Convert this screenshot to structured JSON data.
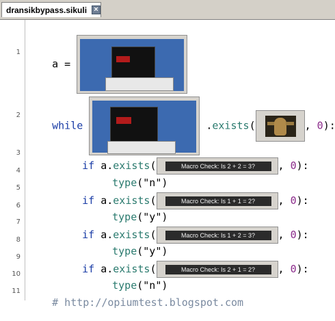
{
  "tab": {
    "title": "dransikbypass.sikuli",
    "close_icon": "close-icon"
  },
  "gutter": {
    "numbers": [
      "1",
      "2",
      "3",
      "4",
      "5",
      "6",
      "7",
      "8",
      "9",
      "10",
      "11"
    ]
  },
  "code": {
    "l1_var": "a",
    "l1_eq": " = ",
    "l2_kw": "while",
    "l2_dot": " .",
    "l2_fn": "exists",
    "l2_open": "(",
    "l2_comma": ", ",
    "l2_num": "0",
    "l2_close": "):",
    "if_kw": "if",
    "a_dot": " a.",
    "exists_fn": "exists",
    "open": "(",
    "comma": ", ",
    "zero": "0",
    "close_colon": "):",
    "type_fn": "type",
    "l4_arg": "(\"n\")",
    "l6_arg": "(\"y\")",
    "l8_arg": "(\"y\")",
    "l10_arg": "(\"n\")",
    "comment": "# http://opiumtest.blogspot.com"
  },
  "patterns": {
    "check1": "Macro Check: Is 2 + 2 = 3?",
    "check2": "Macro Check: Is 1 + 1 = 2?",
    "check3": "Macro Check: Is 1 + 2 = 3?",
    "check4": "Macro Check: Is 2 + 1 = 2?"
  },
  "colors": {
    "keyword": "#1a3ca6",
    "function": "#2a7a6e",
    "number": "#8a2a8a",
    "comment": "#7a8aa0"
  }
}
